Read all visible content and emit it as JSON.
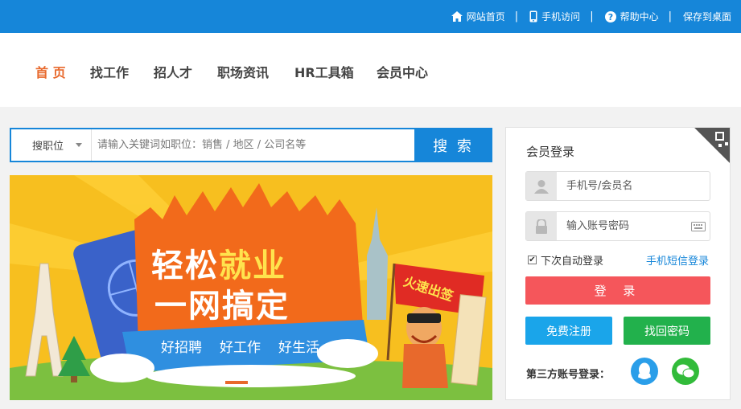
{
  "topbar": {
    "links": [
      {
        "label": "网站首页",
        "icon": "home-icon"
      },
      {
        "label": "手机访问",
        "icon": "mobile-icon"
      },
      {
        "label": "帮助中心",
        "icon": "help-icon"
      },
      {
        "label": "保存到桌面",
        "icon": ""
      }
    ],
    "separator": "|"
  },
  "nav": {
    "items": [
      {
        "label": "首 页",
        "active": true
      },
      {
        "label": "找工作"
      },
      {
        "label": "招人才"
      },
      {
        "label": "职场资讯"
      },
      {
        "label": "HR工具箱"
      },
      {
        "label": "会员中心"
      }
    ]
  },
  "search": {
    "category": "搜职位",
    "placeholder": "请输入关键词如职位：销售 / 地区 / 公司名等",
    "button": "搜 索"
  },
  "banner": {
    "line1_a": "轻松",
    "line1_b": "就业",
    "line2": "一网搞定",
    "tags": [
      "好招聘",
      "好工作",
      "好生活"
    ],
    "flag": "火速出签"
  },
  "login": {
    "title": "会员登录",
    "username_placeholder": "手机号/会员名",
    "password_placeholder": "输入账号密码",
    "remember": "下次自动登录",
    "sms_login": "手机短信登录",
    "login_button": "登 录",
    "register_button": "免费注册",
    "recover_button": "找回密码",
    "third_party": "第三方账号登录："
  },
  "colors": {
    "primary": "#1686d9",
    "active_nav": "#e8692c",
    "login_button": "#f5565b",
    "register_button": "#1aa5ea",
    "recover_button": "#22b14c"
  }
}
